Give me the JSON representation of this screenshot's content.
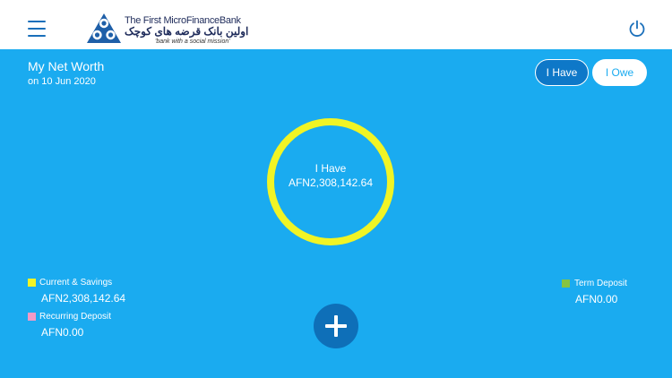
{
  "header": {
    "brand_name": "The First MicroFinanceBank",
    "brand_name_fa": "اولین بانک قرضه های کوچک",
    "tagline": "'bank with a social mission'",
    "menu_icon": "hamburger-menu-icon",
    "power_icon": "power-icon",
    "brand_color": "#1e2b5a"
  },
  "summary": {
    "title": "My Net Worth",
    "date": "on 10 Jun 2020"
  },
  "tabs": [
    {
      "label": "I Have",
      "active": true
    },
    {
      "label": "I Owe",
      "active": false
    }
  ],
  "chart": {
    "center_label": "I Have",
    "center_value": "AFN2,308,142.64",
    "ring_color": "#f1f425"
  },
  "legend": [
    {
      "label": "Current & Savings",
      "value": "AFN2,308,142.64",
      "color": "#f1f425"
    },
    {
      "label": "Recurring Deposit",
      "value": "AFN0.00",
      "color": "#f29ac6"
    },
    {
      "label": "Term Deposit",
      "value": "AFN0.00",
      "color": "#86c442"
    }
  ],
  "colors": {
    "background": "#1aabf0",
    "accent": "#0e6fb8"
  }
}
